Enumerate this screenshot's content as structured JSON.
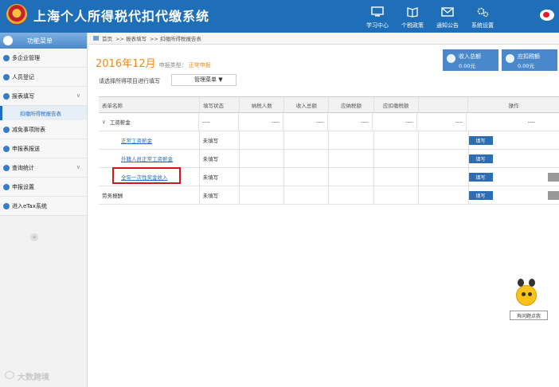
{
  "header": {
    "title": "上海个人所得税代扣代缴系统",
    "nav": [
      {
        "label": "学习中心",
        "icon": "monitor-icon"
      },
      {
        "label": "个税政策",
        "icon": "book-icon"
      },
      {
        "label": "通知公告",
        "icon": "mail-icon"
      },
      {
        "label": "系统设置",
        "icon": "gear-icon"
      }
    ]
  },
  "sidebar": {
    "title": "功能菜单",
    "items": [
      {
        "label": "多企业管理"
      },
      {
        "label": "人员登记"
      },
      {
        "label": "报表填写",
        "expanded": true
      },
      {
        "label": "减免事项附表"
      },
      {
        "label": "申报表报送"
      },
      {
        "label": "查询统计"
      },
      {
        "label": "申报设置"
      },
      {
        "label": "进入eTax系统"
      }
    ],
    "sub_item": "扣缴所得税报告表",
    "collapse_glyph": "«",
    "chevron_glyph": "∨"
  },
  "breadcrumb": {
    "home": "首页",
    "path": [
      ">> 报表填写",
      ">> 扣缴所得税报告表"
    ]
  },
  "period": {
    "date": "2016年12月",
    "type_label": "申报类型：",
    "type": "正常申报"
  },
  "stats": [
    {
      "label": "收入总额",
      "value": "0.00元",
      "icon": "coins-icon"
    },
    {
      "label": "应扣税额",
      "value": "0.00元",
      "icon": "hand-icon"
    }
  ],
  "filter": {
    "label": "请选择所得项目进行填写",
    "select": "管理菜单 ▼"
  },
  "table": {
    "headers": [
      "表单名称",
      "填写状态",
      "纳税人数",
      "收入总额",
      "应纳税额",
      "应扣缴税额",
      "",
      "操作"
    ],
    "group": {
      "name": "工资薪金",
      "caret": "∨",
      "status": "----",
      "values": [
        "----",
        "----",
        "----",
        "----",
        "----"
      ],
      "op": "----"
    },
    "rows": [
      {
        "name": "正常工资薪金",
        "status": "未填写",
        "button": "填写"
      },
      {
        "name": "外籍人员正常工资薪金",
        "status": "未填写",
        "button": "填写"
      },
      {
        "name": "全年一次性奖金收入",
        "status": "未填写",
        "button": "填写"
      }
    ],
    "last_row": {
      "name": "劳务报酬",
      "status": "未填写",
      "button": "填写"
    }
  },
  "assistant": {
    "badge": "有问题点我"
  },
  "watermark": "大数跨境",
  "colors": {
    "header": "#1e6fb8",
    "accent": "#f08a1c",
    "button": "#2c6db3",
    "highlight": "#d4151c"
  }
}
